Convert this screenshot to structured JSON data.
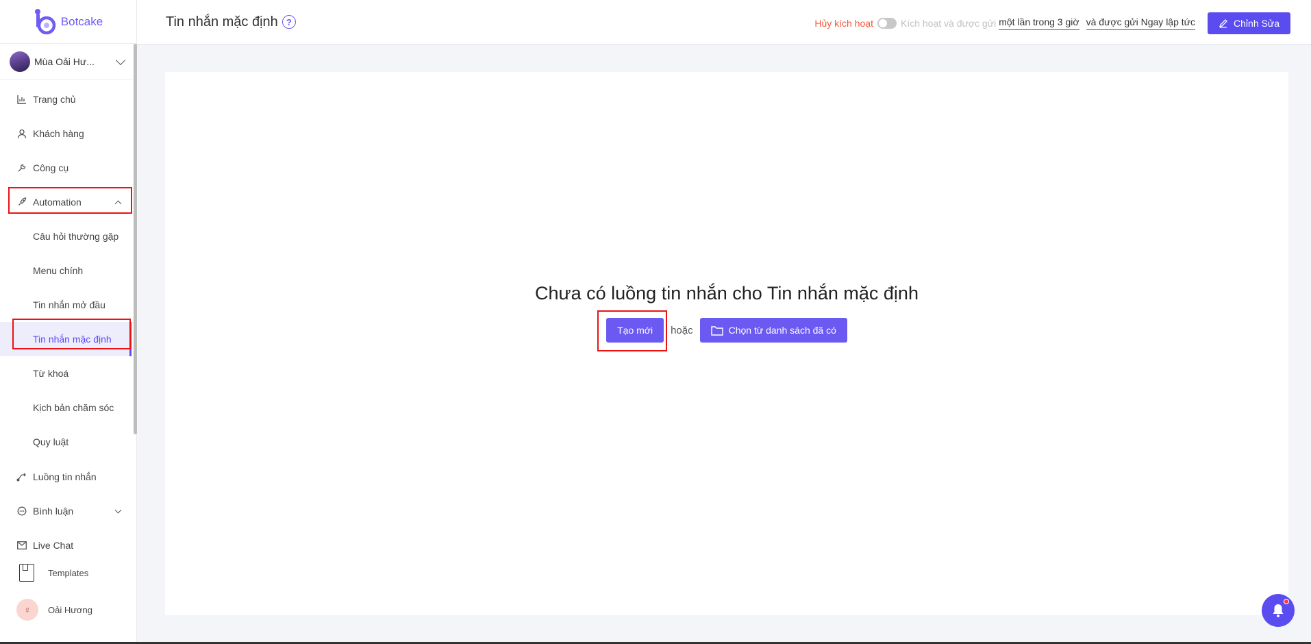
{
  "brand": {
    "name": "Botcake",
    "color": "#6d5cf6"
  },
  "page_selector": {
    "name": "Mùa Oải Hư..."
  },
  "nav": {
    "items": [
      {
        "label": "Trang chủ",
        "icon": "bar-chart-icon"
      },
      {
        "label": "Khách hàng",
        "icon": "user-icon"
      },
      {
        "label": "Công cụ",
        "icon": "wrench-icon"
      },
      {
        "label": "Automation",
        "icon": "rocket-icon"
      }
    ],
    "automation_sub": [
      "Câu hỏi thường gặp",
      "Menu chính",
      "Tin nhắn mở đầu",
      "Tin nhắn mặc định",
      "Từ khoá",
      "Kịch bản chăm sóc",
      "Quy luật"
    ],
    "more": [
      {
        "label": "Luồng tin nhắn",
        "icon": "flow-icon"
      },
      {
        "label": "Bình luận",
        "icon": "comment-icon"
      },
      {
        "label": "Live Chat",
        "icon": "mail-icon"
      }
    ],
    "templates": "Templates",
    "user": "Oải Hương"
  },
  "header": {
    "title": "Tin nhắn mặc định",
    "deactivate": "Hủy kích hoạt",
    "activate_text": "Kích hoạt và được gửi",
    "frequency": "một lần trong 3 giờ",
    "timing": "và được gửi Ngay lập tức",
    "edit_button": "Chỉnh Sửa"
  },
  "main": {
    "empty_message": "Chưa có luồng tin nhắn cho Tin nhắn mặc định",
    "create_button": "Tạo mới",
    "or": "hoặc",
    "choose_button": "Chọn từ danh sách đã có"
  },
  "colors": {
    "accent": "#5b4cf0",
    "deactivate": "#f05a3a",
    "highlight": "#e11111"
  }
}
